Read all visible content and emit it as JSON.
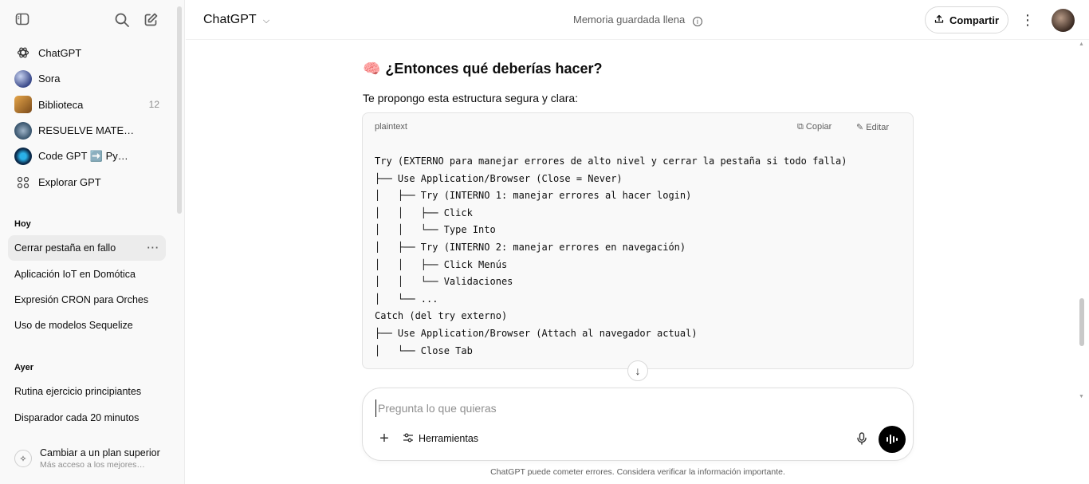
{
  "sidebar": {
    "nav": [
      {
        "label": "ChatGPT",
        "icon": "openai-logo-icon"
      },
      {
        "label": "Sora",
        "icon": "sora-icon"
      },
      {
        "label": "Biblioteca",
        "icon": "library-icon",
        "count": "12"
      },
      {
        "label": "RESUELVE MATE…",
        "icon": "gpt-avatar-icon"
      },
      {
        "label": "Code GPT ➡️ Py…",
        "icon": "code-gpt-icon"
      },
      {
        "label": "Explorar GPT",
        "icon": "grid-icon"
      }
    ],
    "sections": {
      "today": "Hoy",
      "yesterday": "Ayer"
    },
    "today_chats": [
      "Cerrar pestaña en fallo",
      "Aplicación IoT en Domótica",
      "Expresión CRON para Orches",
      "Uso de modelos Sequelize"
    ],
    "yesterday_chats": [
      "Rutina ejercicio principiantes",
      "Disparador cada 20 minutos"
    ],
    "upgrade": {
      "title": "Cambiar a un plan superior",
      "subtitle": "Más acceso a los mejores…"
    }
  },
  "header": {
    "model": "ChatGPT",
    "memory": "Memoria guardada llena",
    "share": "Compartir"
  },
  "content": {
    "heading": "¿Entonces qué deberías hacer?",
    "paragraph": "Te propongo esta estructura segura y clara:",
    "code": {
      "language": "plaintext",
      "copy": "Copiar",
      "edit": "Editar",
      "text": "Try (EXTERNO para manejar errores de alto nivel y cerrar la pestaña si todo falla)\n├── Use Application/Browser (Close = Never)\n│   ├── Try (INTERNO 1: manejar errores al hacer login)\n│   │   ├── Click\n│   │   └── Type Into\n│   ├── Try (INTERNO 2: manejar errores en navegación)\n│   │   ├── Click Menús\n│   │   └── Validaciones\n│   └── ...\nCatch (del try externo)\n├── Use Application/Browser (Attach al navegador actual)\n│   └── Close Tab"
    }
  },
  "composer": {
    "placeholder": "Pregunta lo que quieras",
    "tools": "Herramientas"
  },
  "disclaimer": "ChatGPT puede cometer errores. Considera verificar la información importante."
}
